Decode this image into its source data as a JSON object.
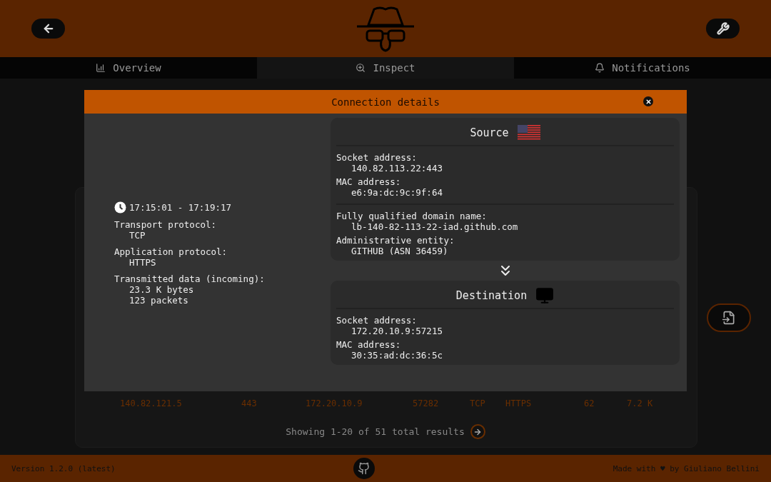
{
  "tabs": [
    {
      "label": "Overview",
      "selected": false
    },
    {
      "label": "Inspect",
      "selected": true
    },
    {
      "label": "Notifications",
      "selected": false
    }
  ],
  "modal": {
    "title": "Connection details",
    "time": "17:15:01 - 17:19:17",
    "info": [
      {
        "label": "Transport protocol:",
        "values": [
          "TCP"
        ]
      },
      {
        "label": "Application protocol:",
        "values": [
          "HTTPS"
        ]
      },
      {
        "label": "Transmitted data (incoming):",
        "values": [
          "23.3 K bytes",
          "123 packets"
        ]
      }
    ],
    "source": {
      "title": "Source",
      "kind": "flag",
      "groups": [
        [
          {
            "label": "Socket address:",
            "value": "140.82.113.22:443"
          },
          {
            "label": "MAC address:",
            "value": "e6:9a:dc:9c:9f:64"
          }
        ],
        [
          {
            "label": "Fully qualified domain name:",
            "value": "lb-140-82-113-22-iad.github.com"
          },
          {
            "label": "Administrative entity:",
            "value": "GITHUB (ASN 36459)"
          }
        ]
      ]
    },
    "destination": {
      "title": "Destination",
      "kind": "computer",
      "groups": [
        [
          {
            "label": "Socket address:",
            "value": "172.20.10.9:57215"
          },
          {
            "label": "MAC address:",
            "value": "30:35:ad:dc:36:5c"
          }
        ]
      ]
    }
  },
  "table_row": [
    "140.82.121.5",
    "443",
    "172.20.10.9",
    "57282",
    "TCP",
    "HTTPS",
    "62",
    "7.2 K"
  ],
  "results": "Showing 1-20 of 51 total results",
  "footer": {
    "version": "Version 1.2.0 (latest)",
    "credit": "Made with ♥ by Giuliano Bellini"
  }
}
